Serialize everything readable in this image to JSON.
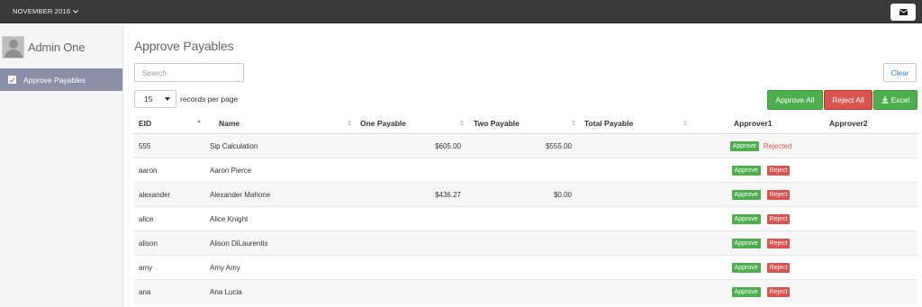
{
  "header": {
    "period_label": "NOVEMBER 2016",
    "mail_icon": "envelope-icon"
  },
  "sidebar": {
    "user_name": "Admin One",
    "items": [
      {
        "label": "Approve Payables",
        "icon": "checkbox-icon",
        "active": true
      }
    ]
  },
  "main": {
    "title": "Approve Payables",
    "search_placeholder": "Search",
    "clear_label": "Clear",
    "page_length": "15",
    "page_length_label": "records per page",
    "approve_all_label": "Approve All",
    "reject_all_label": "Reject All",
    "excel_label": "Excel",
    "colors": {
      "approve": "#4cae4c",
      "reject": "#d9534f",
      "nav_active": "#8c8fa8"
    }
  },
  "table": {
    "columns": [
      "EID",
      "Name",
      "One Payable",
      "Two Payable",
      "Total Payable",
      "Approver1",
      "Approver2"
    ],
    "approve_label": "Approve",
    "reject_label": "Reject",
    "rows": [
      {
        "eid": "555",
        "name": "Sip Calculation",
        "one": "$605.00",
        "two": "$555.00",
        "total": "",
        "status": "Rejected"
      },
      {
        "eid": "aaron",
        "name": "Aaron Pierce",
        "one": "",
        "two": "",
        "total": "",
        "status": ""
      },
      {
        "eid": "alexander",
        "name": "Alexander Mahone",
        "one": "$436.27",
        "two": "$0.00",
        "total": "",
        "status": ""
      },
      {
        "eid": "alice",
        "name": "Alice Knight",
        "one": "",
        "two": "",
        "total": "",
        "status": ""
      },
      {
        "eid": "alison",
        "name": "Alison DiLaurentis",
        "one": "",
        "two": "",
        "total": "",
        "status": ""
      },
      {
        "eid": "amy",
        "name": "Amy Amy",
        "one": "",
        "two": "",
        "total": "",
        "status": ""
      },
      {
        "eid": "ana",
        "name": "Ana Lucia",
        "one": "",
        "two": "",
        "total": "",
        "status": ""
      }
    ]
  }
}
